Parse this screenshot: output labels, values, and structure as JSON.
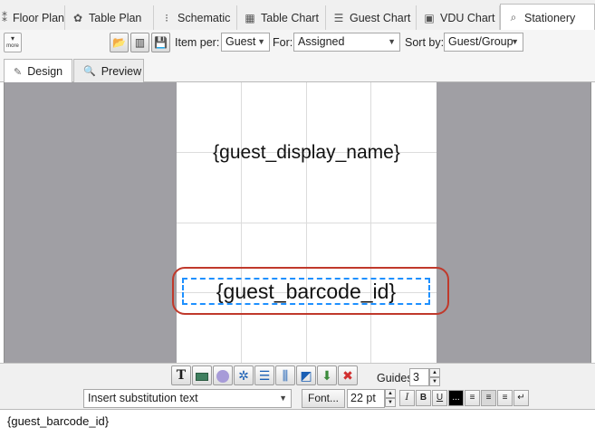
{
  "tabs": [
    {
      "label": "Floor Plan",
      "icon": "floor-plan-icon"
    },
    {
      "label": "Table Plan",
      "icon": "table-plan-icon"
    },
    {
      "label": "Schematic",
      "icon": "schematic-icon"
    },
    {
      "label": "Table Chart",
      "icon": "table-chart-icon"
    },
    {
      "label": "Guest Chart",
      "icon": "guest-chart-icon"
    },
    {
      "label": "VDU Chart",
      "icon": "vdu-chart-icon"
    },
    {
      "label": "Stationery",
      "icon": "stationery-icon",
      "active": true
    }
  ],
  "toolbar": {
    "more_label": "more",
    "item_per_label": "Item per:",
    "item_per_value": "Guest",
    "for_label": "For:",
    "for_value": "Assigned",
    "sort_by_label": "Sort by:",
    "sort_by_value": "Guest/Group"
  },
  "view_tabs": {
    "design": "Design",
    "preview": "Preview",
    "active": "Design"
  },
  "canvas": {
    "field_name": "{guest_display_name}",
    "field_barcode": "{guest_barcode_id}",
    "selected_field": "field_barcode"
  },
  "format_bar": {
    "guides_label": "Guides:",
    "guides_value": "3",
    "substitution_placeholder": "Insert substitution text",
    "font_button": "Font...",
    "font_size": "22 pt",
    "bold": "B",
    "italic": "I",
    "underline": "U",
    "color_label": "...",
    "color_swatch": "#000000"
  },
  "text_entry": {
    "value": "{guest_barcode_id}"
  },
  "colors": {
    "canvas_bg": "#a09fa4",
    "selection_dash": "#1e90ff",
    "highlight_ring": "#c0392b"
  }
}
